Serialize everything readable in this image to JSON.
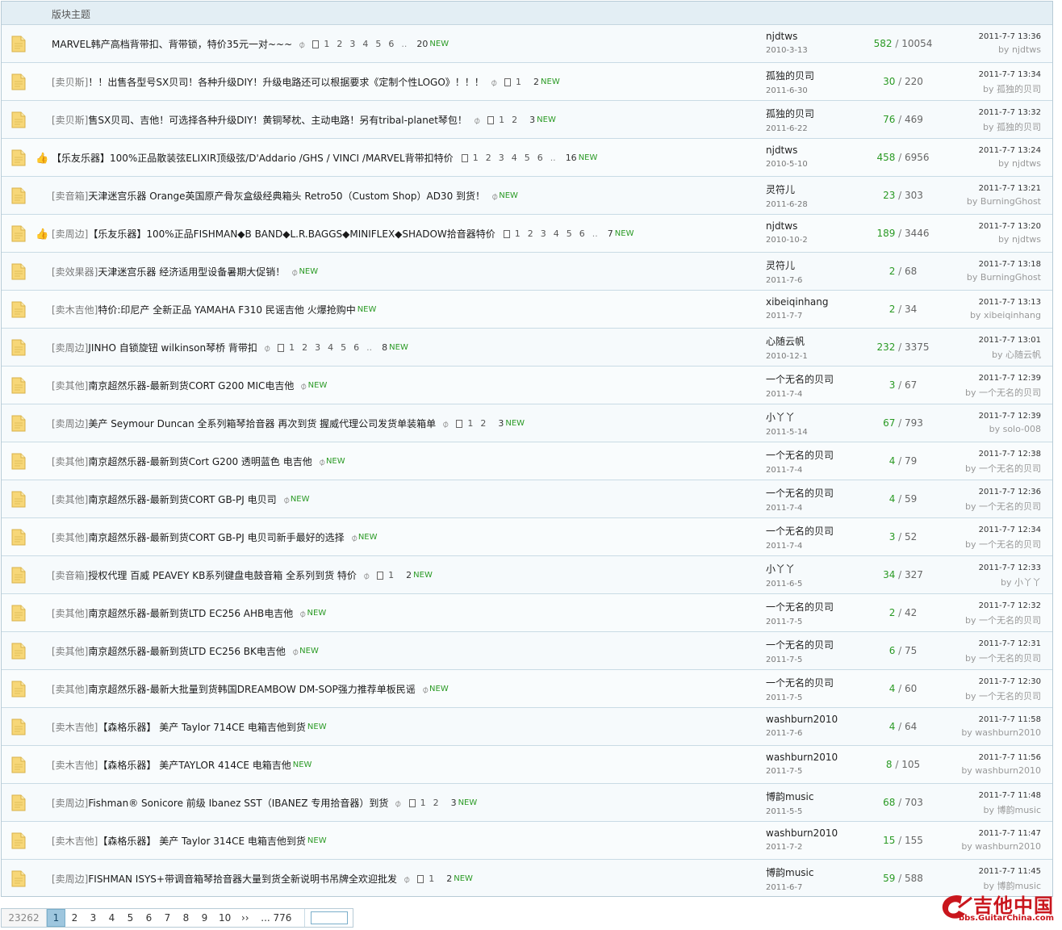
{
  "header": {
    "label": "版块主题"
  },
  "topics": [
    {
      "cat": "",
      "title": "MARVEL韩产高档背带扣、背带锁，特价35元一对~~~",
      "hot": false,
      "clip": true,
      "pages": [
        "1",
        "2",
        "3",
        "4",
        "5",
        "6"
      ],
      "ellipsis": true,
      "new_count": "20",
      "author": "njdtws",
      "date": "2010-3-13",
      "replies": "582",
      "views": "10054",
      "last_time": "2011-7-7 13:36",
      "last_by": "by njdtws"
    },
    {
      "cat": "[卖贝斯]",
      "title": "！！出售各型号SX贝司！各种升级DIY！升级电路还可以根据要求《定制个性LOGO》！！！",
      "hot": false,
      "clip": true,
      "pages": [
        "1"
      ],
      "ellipsis": false,
      "new_count": "2",
      "author": "孤独的贝司",
      "date": "2011-6-30",
      "replies": "30",
      "views": "220",
      "last_time": "2011-7-7 13:34",
      "last_by": "by 孤独的贝司"
    },
    {
      "cat": "[卖贝斯]",
      "title": "售SX贝司、吉他！可选择各种升级DIY！黄铜琴枕、主动电路！另有tribal-planet琴包！",
      "hot": false,
      "clip": true,
      "pages": [
        "1",
        "2"
      ],
      "ellipsis": false,
      "new_count": "3",
      "author": "孤独的贝司",
      "date": "2011-6-22",
      "replies": "76",
      "views": "469",
      "last_time": "2011-7-7 13:32",
      "last_by": "by 孤独的贝司"
    },
    {
      "cat": "",
      "title": "【乐友乐器】100%正品散装弦ELIXIR顶级弦/D'Addario /GHS / VINCI /MARVEL背带扣特价",
      "hot": true,
      "clip": false,
      "pages": [
        "1",
        "2",
        "3",
        "4",
        "5",
        "6"
      ],
      "ellipsis": true,
      "new_count": "16",
      "author": "njdtws",
      "date": "2010-5-10",
      "replies": "458",
      "views": "6956",
      "last_time": "2011-7-7 13:24",
      "last_by": "by njdtws"
    },
    {
      "cat": "[卖音箱]",
      "title": "天津迷宫乐器 Orange英国原产骨灰盒级经典箱头 Retro50（Custom Shop）AD30 到货！",
      "hot": false,
      "clip": true,
      "pages": [],
      "ellipsis": false,
      "new_count": "",
      "author": "灵符儿",
      "date": "2011-6-28",
      "replies": "23",
      "views": "303",
      "last_time": "2011-7-7 13:21",
      "last_by": "by BurningGhost"
    },
    {
      "cat": "[卖周边]",
      "title": "【乐友乐器】100%正品FISHMAN◆B BAND◆L.R.BAGGS◆MINIFLEX◆SHADOW拾音器特价",
      "hot": true,
      "clip": false,
      "pages": [
        "1",
        "2",
        "3",
        "4",
        "5",
        "6"
      ],
      "ellipsis": true,
      "new_count": "7",
      "author": "njdtws",
      "date": "2010-10-2",
      "replies": "189",
      "views": "3446",
      "last_time": "2011-7-7 13:20",
      "last_by": "by njdtws"
    },
    {
      "cat": "[卖效果器]",
      "title": "天津迷宫乐器 经济适用型设备暑期大促销！",
      "hot": false,
      "clip": true,
      "pages": [],
      "ellipsis": false,
      "new_count": "",
      "author": "灵符儿",
      "date": "2011-7-6",
      "replies": "2",
      "views": "68",
      "last_time": "2011-7-7 13:18",
      "last_by": "by BurningGhost"
    },
    {
      "cat": "[卖木吉他]",
      "title": "特价:印尼产 全新正品 YAMAHA F310 民谣吉他 火爆抢购中",
      "hot": false,
      "clip": false,
      "pages": [],
      "ellipsis": false,
      "new_count": "",
      "author": "xibeiqinhang",
      "date": "2011-7-7",
      "replies": "2",
      "views": "34",
      "last_time": "2011-7-7 13:13",
      "last_by": "by xibeiqinhang"
    },
    {
      "cat": "[卖周边]",
      "title": "JINHO 自锁旋钮 wilkinson琴桥 背带扣",
      "hot": false,
      "clip": true,
      "pages": [
        "1",
        "2",
        "3",
        "4",
        "5",
        "6"
      ],
      "ellipsis": true,
      "new_count": "8",
      "author": "心随云帆",
      "date": "2010-12-1",
      "replies": "232",
      "views": "3375",
      "last_time": "2011-7-7 13:01",
      "last_by": "by 心随云帆"
    },
    {
      "cat": "[卖其他]",
      "title": "南京超然乐器-最新到货CORT G200 MIC电吉他",
      "hot": false,
      "clip": true,
      "pages": [],
      "ellipsis": false,
      "new_count": "",
      "author": "一个无名的贝司",
      "date": "2011-7-4",
      "replies": "3",
      "views": "67",
      "last_time": "2011-7-7 12:39",
      "last_by": "by 一个无名的贝司"
    },
    {
      "cat": "[卖周边]",
      "title": "美产 Seymour Duncan 全系列箱琴拾音器 再次到货 握威代理公司发货单装箱单",
      "hot": false,
      "clip": true,
      "pages": [
        "1",
        "2"
      ],
      "ellipsis": false,
      "new_count": "3",
      "author": "小丫丫",
      "date": "2011-5-14",
      "replies": "67",
      "views": "793",
      "last_time": "2011-7-7 12:39",
      "last_by": "by solo-008"
    },
    {
      "cat": "[卖其他]",
      "title": "南京超然乐器-最新到货Cort G200 透明蓝色 电吉他",
      "hot": false,
      "clip": true,
      "pages": [],
      "ellipsis": false,
      "new_count": "",
      "author": "一个无名的贝司",
      "date": "2011-7-4",
      "replies": "4",
      "views": "79",
      "last_time": "2011-7-7 12:38",
      "last_by": "by 一个无名的贝司"
    },
    {
      "cat": "[卖其他]",
      "title": "南京超然乐器-最新到货CORT GB-PJ 电贝司",
      "hot": false,
      "clip": true,
      "pages": [],
      "ellipsis": false,
      "new_count": "",
      "author": "一个无名的贝司",
      "date": "2011-7-4",
      "replies": "4",
      "views": "59",
      "last_time": "2011-7-7 12:36",
      "last_by": "by 一个无名的贝司"
    },
    {
      "cat": "[卖其他]",
      "title": "南京超然乐器-最新到货CORT GB-PJ 电贝司新手最好的选择",
      "hot": false,
      "clip": true,
      "pages": [],
      "ellipsis": false,
      "new_count": "",
      "author": "一个无名的贝司",
      "date": "2011-7-4",
      "replies": "3",
      "views": "52",
      "last_time": "2011-7-7 12:34",
      "last_by": "by 一个无名的贝司"
    },
    {
      "cat": "[卖音箱]",
      "title": "授权代理 百威 PEAVEY KB系列键盘电鼓音箱 全系列到货 特价",
      "hot": false,
      "clip": true,
      "pages": [
        "1"
      ],
      "ellipsis": false,
      "new_count": "2",
      "author": "小丫丫",
      "date": "2011-6-5",
      "replies": "34",
      "views": "327",
      "last_time": "2011-7-7 12:33",
      "last_by": "by 小丫丫"
    },
    {
      "cat": "[卖其他]",
      "title": "南京超然乐器-最新到货LTD EC256 AHB电吉他",
      "hot": false,
      "clip": true,
      "pages": [],
      "ellipsis": false,
      "new_count": "",
      "author": "一个无名的贝司",
      "date": "2011-7-5",
      "replies": "2",
      "views": "42",
      "last_time": "2011-7-7 12:32",
      "last_by": "by 一个无名的贝司"
    },
    {
      "cat": "[卖其他]",
      "title": "南京超然乐器-最新到货LTD EC256 BK电吉他",
      "hot": false,
      "clip": true,
      "pages": [],
      "ellipsis": false,
      "new_count": "",
      "author": "一个无名的贝司",
      "date": "2011-7-5",
      "replies": "6",
      "views": "75",
      "last_time": "2011-7-7 12:31",
      "last_by": "by 一个无名的贝司"
    },
    {
      "cat": "[卖其他]",
      "title": "南京超然乐器-最新大批量到货韩国DREAMBOW DM-SOP强力推荐单板民谣",
      "hot": false,
      "clip": true,
      "pages": [],
      "ellipsis": false,
      "new_count": "",
      "author": "一个无名的贝司",
      "date": "2011-7-5",
      "replies": "4",
      "views": "60",
      "last_time": "2011-7-7 12:30",
      "last_by": "by 一个无名的贝司"
    },
    {
      "cat": "[卖木吉他]",
      "title": "【森格乐器】 美产 Taylor 714CE 电箱吉他到货",
      "hot": false,
      "clip": false,
      "pages": [],
      "ellipsis": false,
      "new_count": "",
      "author": "washburn2010",
      "date": "2011-7-6",
      "replies": "4",
      "views": "64",
      "last_time": "2011-7-7 11:58",
      "last_by": "by washburn2010"
    },
    {
      "cat": "[卖木吉他]",
      "title": "【森格乐器】 美产TAYLOR 414CE 电箱吉他",
      "hot": false,
      "clip": false,
      "pages": [],
      "ellipsis": false,
      "new_count": "",
      "author": "washburn2010",
      "date": "2011-7-5",
      "replies": "8",
      "views": "105",
      "last_time": "2011-7-7 11:56",
      "last_by": "by washburn2010"
    },
    {
      "cat": "[卖周边]",
      "title": "Fishman® Sonicore 前级 Ibanez SST（IBANEZ 专用拾音器）到货",
      "hot": false,
      "clip": true,
      "pages": [
        "1",
        "2"
      ],
      "ellipsis": false,
      "new_count": "3",
      "author": "博韵music",
      "date": "2011-5-5",
      "replies": "68",
      "views": "703",
      "last_time": "2011-7-7 11:48",
      "last_by": "by 博韵music"
    },
    {
      "cat": "[卖木吉他]",
      "title": "【森格乐器】 美产 Taylor 314CE 电箱吉他到货",
      "hot": false,
      "clip": false,
      "pages": [],
      "ellipsis": false,
      "new_count": "",
      "author": "washburn2010",
      "date": "2011-7-2",
      "replies": "15",
      "views": "155",
      "last_time": "2011-7-7 11:47",
      "last_by": "by washburn2010"
    },
    {
      "cat": "[卖周边]",
      "title": "FISHMAN ISYS+带调音箱琴拾音器大量到货全新说明书吊牌全欢迎批发",
      "hot": false,
      "clip": true,
      "pages": [
        "1"
      ],
      "ellipsis": false,
      "new_count": "2",
      "author": "博韵music",
      "date": "2011-6-7",
      "replies": "59",
      "views": "588",
      "last_time": "2011-7-7 11:45",
      "last_by": "by 博韵music"
    }
  ],
  "new_label": "NEW",
  "stat_sep": " / ",
  "ellipsis_text": "..",
  "pagination": {
    "total": "23262",
    "current": "1",
    "pages": [
      "2",
      "3",
      "4",
      "5",
      "6",
      "7",
      "8",
      "9",
      "10"
    ],
    "next": "››",
    "last": "... 776",
    "jump_value": ""
  },
  "watermark": {
    "main": "吉他中国",
    "sub": "bbs.GuitarChina.com"
  },
  "colors": {
    "accent_green": "#2a9a24",
    "header_bg": "#e3eef4",
    "border": "#c9dbe5",
    "current_page": "#9ec6de",
    "watermark_red": "#c9161d"
  }
}
